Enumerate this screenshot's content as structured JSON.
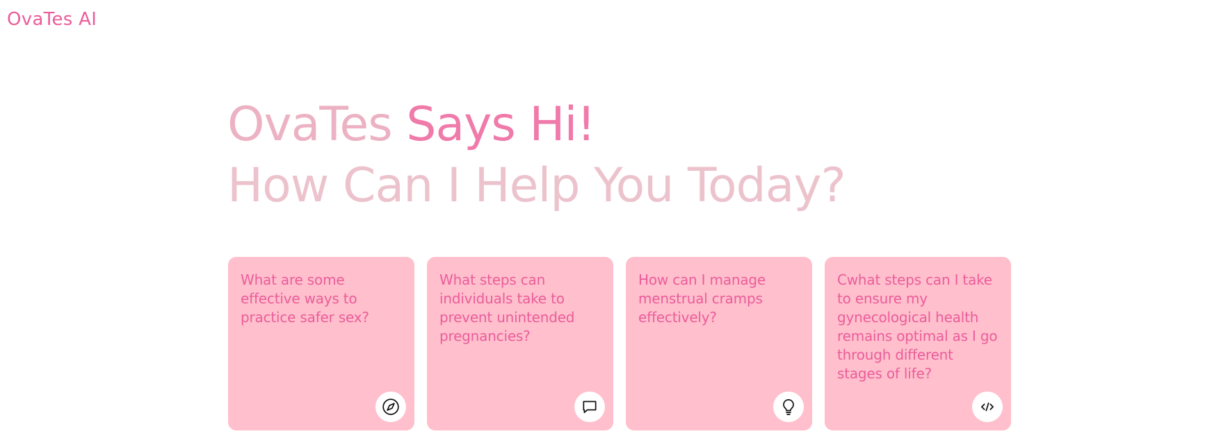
{
  "header": {
    "brand": "OvaTes AI"
  },
  "greeting": {
    "line1_prefix": "OvaTes ",
    "line1_suffix": "Says Hi!",
    "line2": "How Can I Help You Today?"
  },
  "cards": [
    {
      "text": "What are some effective ways to practice safer sex?",
      "icon": "compass-icon"
    },
    {
      "text": "What steps can individuals take to prevent unintended pregnancies?",
      "icon": "message-icon"
    },
    {
      "text": "How can I manage menstrual cramps effectively?",
      "icon": "lightbulb-icon"
    },
    {
      "text": "Cwhat steps can I take to ensure my gynecological health remains optimal as I go through different stages of life?",
      "icon": "code-icon"
    }
  ],
  "colors": {
    "brand": "#ea5d9b",
    "greeting_light": "#ecb2c3",
    "greeting_accent": "#f07aa9",
    "subheading": "#ecc3cd",
    "card_bg": "#ffbfcc",
    "card_text": "#ea5d9b"
  }
}
